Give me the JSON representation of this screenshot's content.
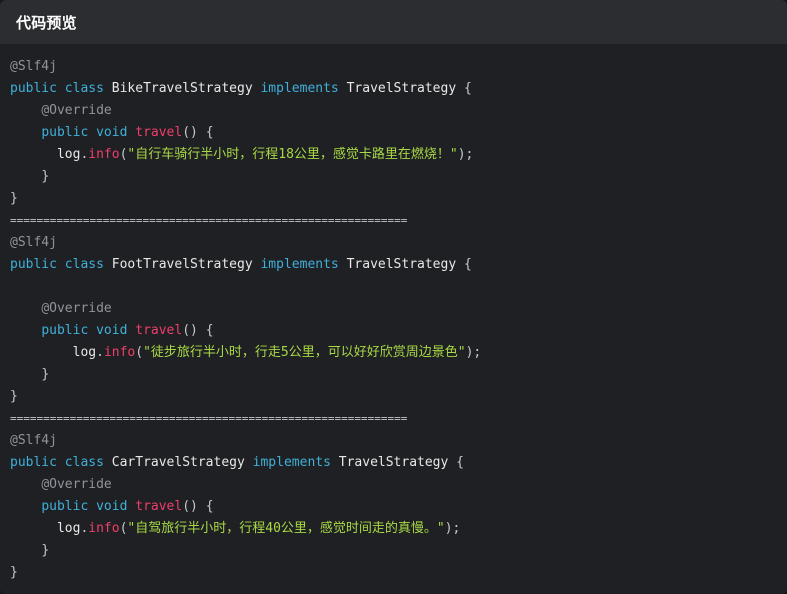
{
  "header": {
    "title": "代码预览"
  },
  "code": {
    "separator": "============================================================",
    "block1": {
      "annotation": "@Slf4j",
      "kw_public": "public",
      "kw_class": "class",
      "class_name": "BikeTravelStrategy",
      "kw_implements": "implements",
      "interface_name": "TravelStrategy",
      "open_brace": " {",
      "override": "@Override",
      "kw_void": "void",
      "method": "travel",
      "method_sig": "() {",
      "log": "log",
      "dot": ".",
      "info": "info",
      "call_open": "(",
      "string": "\"自行车骑行半小时，行程18公里，感觉卡路里在燃烧！\"",
      "call_close": ");",
      "close_inner": "}",
      "close_outer": "}"
    },
    "block2": {
      "annotation": "@Slf4j",
      "kw_public": "public",
      "kw_class": "class",
      "class_name": "FootTravelStrategy",
      "kw_implements": "implements",
      "interface_name": "TravelStrategy",
      "open_brace": " {",
      "override": "@Override",
      "kw_void": "void",
      "method": "travel",
      "method_sig": "() {",
      "log": "log",
      "dot": ".",
      "info": "info",
      "call_open": "(",
      "string": "\"徒步旅行半小时，行走5公里，可以好好欣赏周边景色\"",
      "call_close": ");",
      "close_inner": "}",
      "close_outer": "}"
    },
    "block3": {
      "annotation": "@Slf4j",
      "kw_public": "public",
      "kw_class": "class",
      "class_name": "CarTravelStrategy",
      "kw_implements": "implements",
      "interface_name": "TravelStrategy",
      "open_brace": " {",
      "override": "@Override",
      "kw_void": "void",
      "method": "travel",
      "method_sig": "() {",
      "log": "log",
      "dot": ".",
      "info": "info",
      "call_open": "(",
      "string": "\"自驾旅行半小时，行程40公里，感觉时间走的真慢。\"",
      "call_close": ");",
      "close_inner": "}",
      "close_outer": "}"
    }
  },
  "colors": {
    "keyword": "#3fb0d9",
    "annotation": "#8f949b",
    "method": "#ef3f6b",
    "string": "#a8d946",
    "background": "#1f2023",
    "header_bg": "#2b2d31"
  }
}
